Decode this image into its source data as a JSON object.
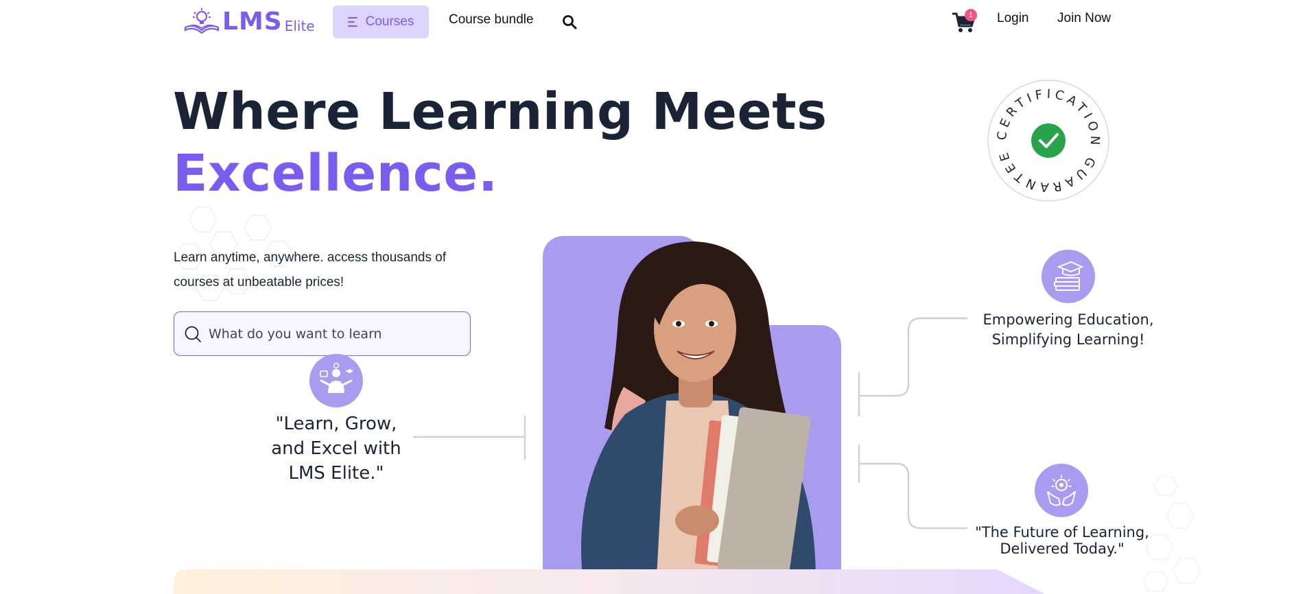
{
  "brand": {
    "main": "LMS",
    "sub": "Elite",
    "color": "#7b5cf0"
  },
  "nav": {
    "courses_label": "Courses",
    "bundle_label": "Course bundle",
    "cart_count": "1",
    "login_label": "Login",
    "join_label": "Join Now",
    "icons": [
      "menu-icon",
      "search-icon",
      "cart-icon"
    ]
  },
  "hero": {
    "title_line1": "Where Learning Meets",
    "title_line2": "Excellence.",
    "description": "Learn anytime, anywhere. access thousands of courses at unbeatable prices!",
    "search_placeholder": "What do you want to learn"
  },
  "badge": {
    "ring_text": "CERTIFICATION GUARANTEE",
    "check_color": "#27a34a"
  },
  "features": [
    {
      "icon": "student-learning-icon",
      "text": "\"Learn, Grow, and Excel with LMS Elite.\""
    },
    {
      "icon": "graduation-books-icon",
      "text": "Empowering Education, Simplifying Learning!"
    },
    {
      "icon": "hands-idea-icon",
      "text": "\"The Future of Learning, Delivered Today.\""
    }
  ],
  "colors": {
    "accent": "#7b5cf0",
    "accent_soft": "#a99bf0",
    "nav_highlight": "#ddd4fb",
    "text": "#1b2336",
    "cart_badge": "#f2567f"
  }
}
